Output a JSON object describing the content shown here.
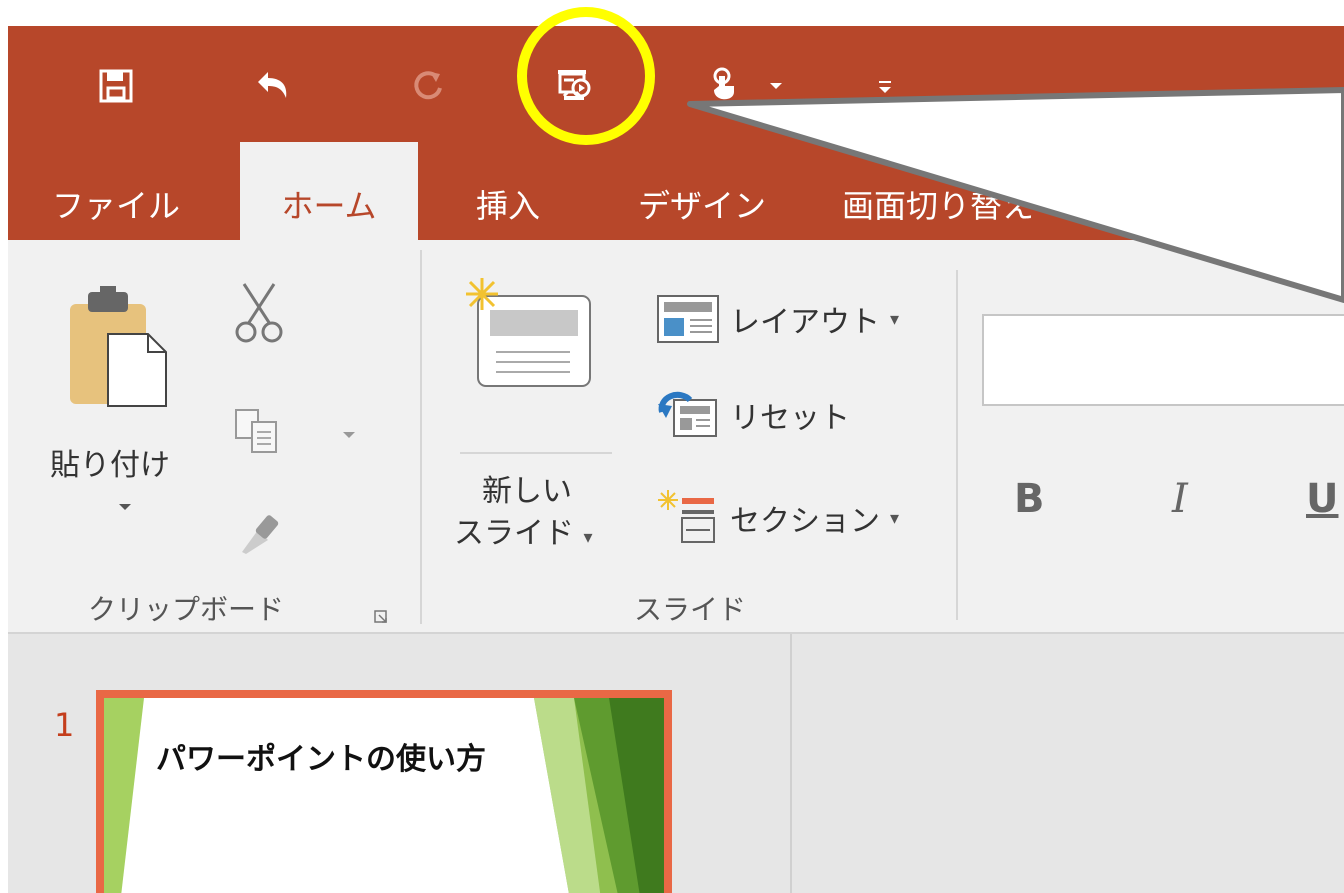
{
  "colors": {
    "accent": "#b7472a",
    "ribbon_bg": "#f1f1f1",
    "highlight": "#ffff00",
    "slide_border": "#e96845"
  },
  "quick_access": {
    "items": [
      {
        "icon": "save-icon"
      },
      {
        "icon": "undo-icon"
      },
      {
        "icon": "redo-icon",
        "disabled": true
      },
      {
        "icon": "slideshow-from-beginning-icon",
        "highlighted": true
      },
      {
        "icon": "touch-mode-icon"
      },
      {
        "icon": "customize-toolbar-icon"
      }
    ]
  },
  "tabs": {
    "file": "ファイル",
    "home": "ホーム",
    "insert": "挿入",
    "design": "デザイン",
    "transitions": "画面切り替え"
  },
  "ribbon": {
    "clipboard": {
      "paste": "貼り付け",
      "group_label": "クリップボード"
    },
    "slides": {
      "new_slide_line1": "新しい",
      "new_slide_line2": "スライド",
      "layout": "レイアウト",
      "reset": "リセット",
      "section": "セクション",
      "group_label": "スライド"
    },
    "font": {
      "bold": "B",
      "italic": "I",
      "underline": "U"
    }
  },
  "slides_panel": {
    "slide_number": "1",
    "slide_title": "パワーポイントの使い方"
  }
}
